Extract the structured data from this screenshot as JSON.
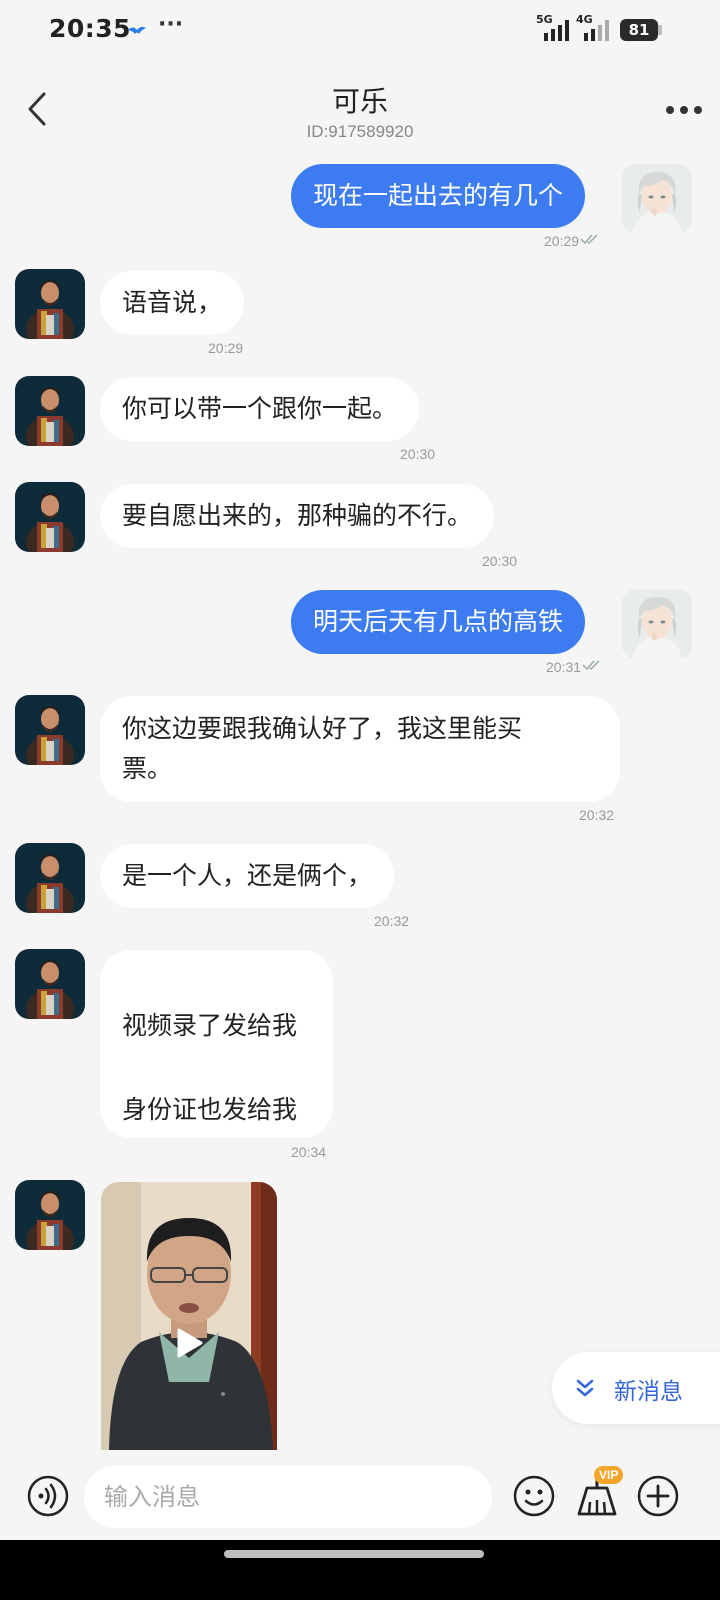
{
  "status_bar": {
    "time": "20:35",
    "dots": "···",
    "signal1_label": "5G",
    "signal2_label": "4G",
    "battery": "81"
  },
  "header": {
    "title": "可乐",
    "subtitle": "ID:917589920"
  },
  "messages": [
    {
      "side": "out",
      "text": "现在一起出去的有几个",
      "time": "20:29",
      "read": true
    },
    {
      "side": "in",
      "text": "语音说，",
      "time": "20:29"
    },
    {
      "side": "in",
      "text": "你可以带一个跟你一起。",
      "time": "20:30"
    },
    {
      "side": "in",
      "text": "要自愿出来的，那种骗的不行。",
      "time": "20:30"
    },
    {
      "side": "out",
      "text": "明天后天有几点的高铁",
      "time": "20:31",
      "read": true
    },
    {
      "side": "in",
      "text": "你这边要跟我确认好了，我这里能买\n票。",
      "time": "20:32"
    },
    {
      "side": "in",
      "text": "是一个人，还是俩个，",
      "time": "20:32"
    },
    {
      "side": "in",
      "text": "\n视频录了发给我\n\n身份证也发给我",
      "time": "20:34"
    },
    {
      "side": "in",
      "type": "video"
    }
  ],
  "new_messages_label": "新消息",
  "input": {
    "placeholder": "输入消息",
    "vip_badge": "VIP"
  },
  "colors": {
    "outgoing_bubble": "#3c7cf0",
    "incoming_bubble": "#ffffff",
    "background": "#f5f5f5",
    "accent_text": "#3567d6",
    "vip": "#f4a52a"
  },
  "icons": [
    "back-icon",
    "more-icon",
    "double-check-icon",
    "play-icon",
    "chevron-double-down-icon",
    "voice-icon",
    "emoji-icon",
    "broom-icon",
    "plus-icon"
  ]
}
